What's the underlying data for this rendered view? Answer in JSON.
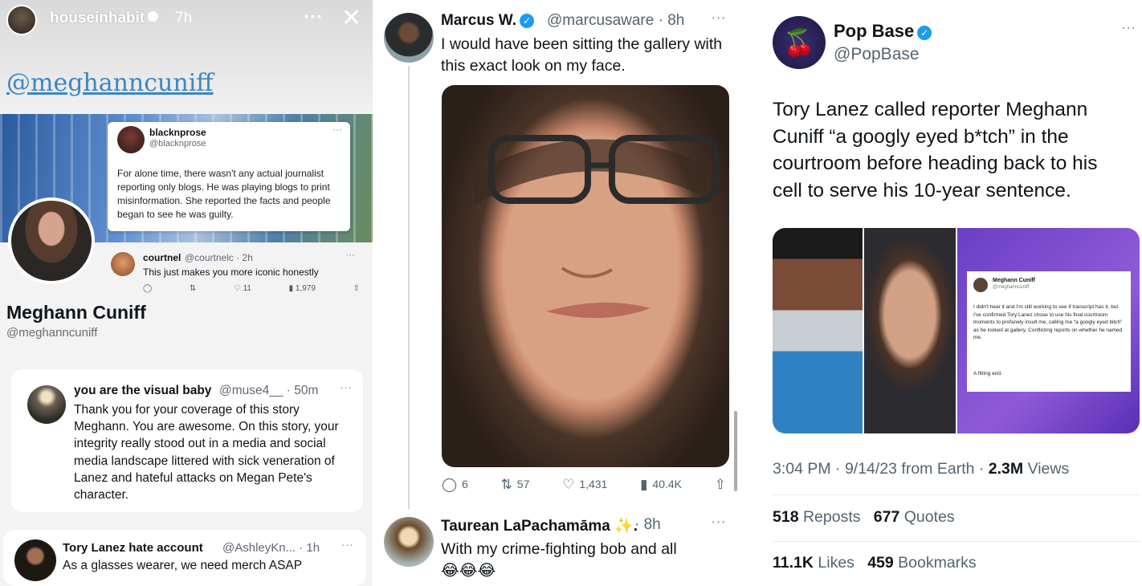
{
  "story": {
    "username": "houseinhabit",
    "time": "7h",
    "more": "···",
    "close": "✕",
    "mention": "@meghanncuniff",
    "quoted_tweet": {
      "name": "blacknprose",
      "handle": "@blacknprose",
      "more": "···",
      "text": "For alone time, there wasn't any actual journalist reporting only blogs. He was playing blogs to print misinformation. She reported the facts and people began to see he was guilty."
    },
    "profile": {
      "name": "Meghann Cuniff",
      "handle": "@meghanncuniff"
    },
    "reply_mini": {
      "name": "courtnel",
      "handle": "@courtnelc · 2h",
      "more": "···",
      "text": "This just makes you more iconic honestly",
      "likes": "11",
      "views": "1,979"
    },
    "card1": {
      "name": "you are the visual baby",
      "handle": "@muse4__ · 50m",
      "more": "···",
      "text": "Thank you for your coverage of this story Meghann. You are awesome. On this story, your integrity really stood out in a media and social media landscape littered with sick veneration of Lanez and hateful attacks on Megan Pete's character."
    },
    "card2": {
      "name": "Tory Lanez hate account",
      "handle": "@AshleyKn... · 1h",
      "more": "···",
      "text": "As a glasses wearer, we need merch ASAP"
    }
  },
  "tweet2": {
    "name": "Marcus W.",
    "handle": "@marcusaware · 8h",
    "more": "···",
    "text": "I would have been sitting the gallery with this exact look on my face.",
    "replies": "6",
    "reposts": "57",
    "likes": "1,431",
    "views": "40.4K"
  },
  "tweet3": {
    "name": "Taurean LaPachamāma ✨.",
    "handle": "· 8h",
    "more": "···",
    "text": "With my crime-fighting bob and all",
    "emojis": "😂😂😂"
  },
  "popbase": {
    "name": "Pop Base",
    "handle": "@PopBase",
    "more": "···",
    "text": "Tory Lanez called reporter Meghann Cuniff “a googly eyed b*tch” in the courtroom before heading back to his cell to serve his 10-year sentence.",
    "media_card": {
      "name": "Meghann Cuniff",
      "handle": "@meghanncuniff",
      "text": "I didn't hear it and I'm still working to see if transcript has it, but I've confirmed Tory Lanez chose to use his final courtroom moments to profanely insult me, calling me “a googly eyed bitch” as he looked at gallery. Conflicting reports on whether he named me.",
      "end": "A fitting end."
    },
    "timestamp": "3:04 PM · 9/14/23 from Earth · ",
    "views_count": "2.3M",
    "views_label": " Views",
    "reposts_count": "518",
    "reposts_label": " Reposts",
    "quotes_count": "677",
    "quotes_label": " Quotes",
    "likes_count": "11.1K",
    "likes_label": " Likes",
    "bookmarks_count": "459",
    "bookmarks_label": " Bookmarks"
  }
}
